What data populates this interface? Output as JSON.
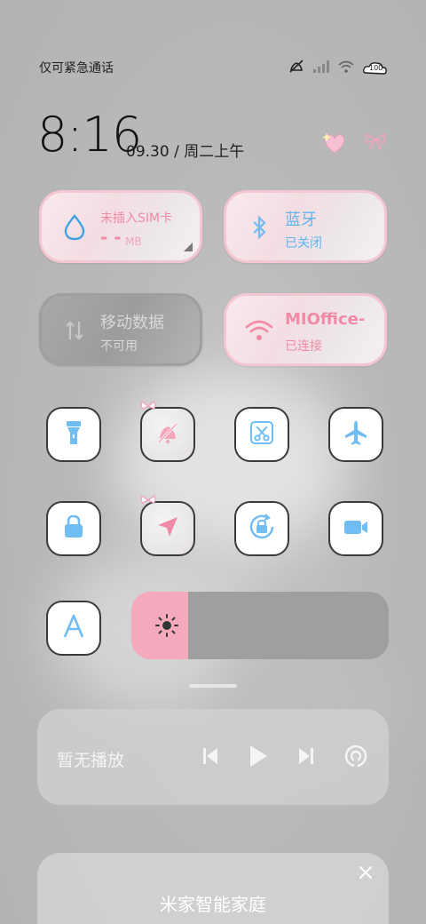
{
  "status_bar": {
    "carrier_text": "仅可紧急通话",
    "icons": [
      "mute-bell-icon",
      "signal-icon",
      "wifi-icon",
      "battery-icon"
    ],
    "battery": "100"
  },
  "clock": {
    "time": "8:16",
    "date": "09.30 / 周二上午"
  },
  "deco": [
    "heart-icon",
    "bow-icon"
  ],
  "tiles": {
    "sim": {
      "title": "未插入SIM卡",
      "value": "- -",
      "unit": "MB",
      "icon": "water-drop-icon"
    },
    "bluetooth": {
      "title": "蓝牙",
      "status": "已关闭",
      "icon": "bluetooth-icon"
    },
    "mobile_data": {
      "title": "移动数据",
      "status": "不可用",
      "icon": "mobile-data-icon"
    },
    "wifi": {
      "title": "MIOffice-",
      "status": "已连接",
      "icon": "wifi-icon"
    }
  },
  "quick_buttons": [
    [
      "flashlight-icon",
      "mute-bell-icon",
      "screenshot-icon",
      "airplane-icon"
    ],
    [
      "lock-icon",
      "location-icon",
      "auto-rotate-icon",
      "video-icon"
    ],
    [
      "font-icon"
    ]
  ],
  "brightness": {
    "level": 0.22,
    "icon": "sun-icon"
  },
  "media": {
    "status": "暂无播放"
  },
  "home_card": {
    "title": "米家智能家庭"
  },
  "colors": {
    "accent_pink": "#f4a9bd",
    "accent_blue": "#5fb5f0",
    "tile_border": "#f4c6d1"
  }
}
